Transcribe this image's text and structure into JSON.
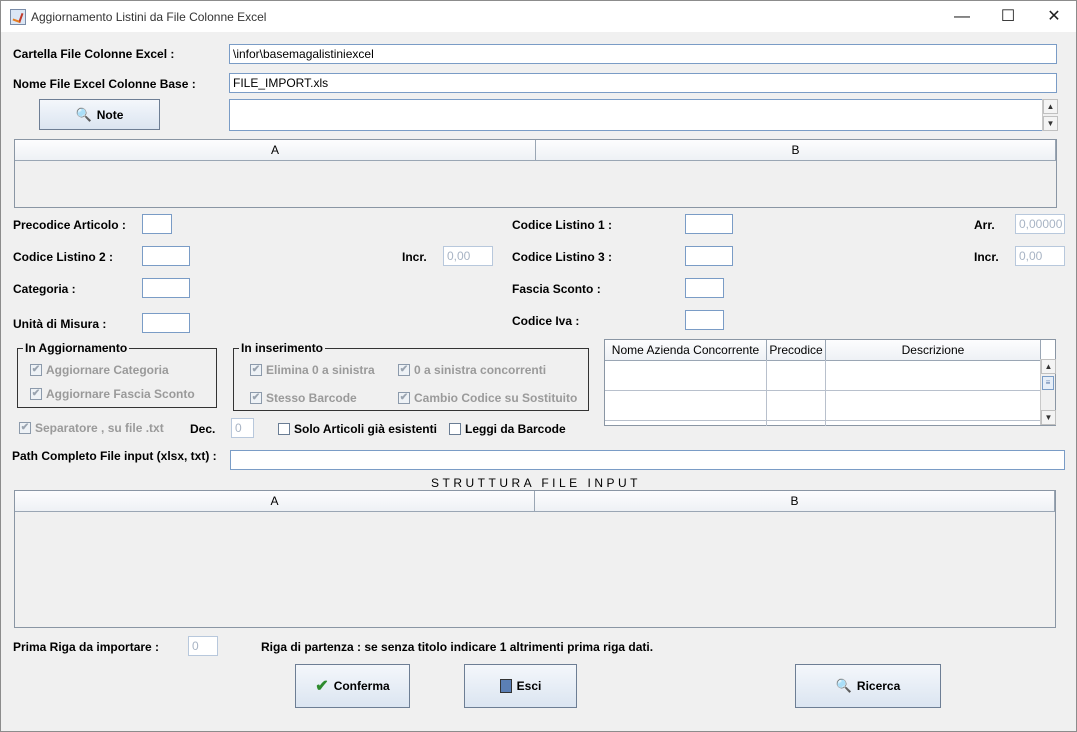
{
  "window": {
    "title": "Aggiornamento Listini da File Colonne Excel",
    "controls": {
      "minimize": "—",
      "maximize": "☐",
      "close": "✕"
    }
  },
  "form": {
    "cartella_label": "Cartella File Colonne Excel :",
    "cartella_value": "\\infor\\basemagalistiniexcel",
    "nomefile_label": "Nome File Excel Colonne Base :",
    "nomefile_value": "FILE_IMPORT.xls",
    "note_button": "Note",
    "precodice_label": "Precodice Articolo :",
    "cod_listino1_label": "Codice Listino 1 :",
    "arr_label": "Arr.",
    "arr_value": "0,00000",
    "cod_listino2_label": "Codice Listino 2 :",
    "incr_label_1": "Incr.",
    "incr_value_1": "0,00",
    "cod_listino3_label": "Codice Listino 3 :",
    "incr_label_2": "Incr.",
    "incr_value_2": "0,00",
    "categoria_label": "Categoria  :",
    "fascia_label": "Fascia Sconto :",
    "unita_label": "Unità di Misura :",
    "codice_iva_label": "Codice Iva :",
    "dec_label": "Dec.",
    "dec_value": "0",
    "path_label": "Path Completo File input (xlsx, txt) :",
    "prima_riga_label": "Prima Riga da importare :",
    "prima_riga_value": "0",
    "riga_partenza_note": "Riga di partenza : se senza titolo indicare 1 altrimenti prima riga dati."
  },
  "top_table": {
    "columns": [
      "A",
      "B"
    ]
  },
  "structure": {
    "title": "STRUTTURA FILE INPUT",
    "columns": [
      "A",
      "B"
    ]
  },
  "group_aggiornamento": {
    "title": "In Aggiornamento",
    "items": [
      "Aggiornare Categoria",
      "Aggiornare Fascia Sconto"
    ]
  },
  "group_inserimento": {
    "title": "In inserimento",
    "items": [
      "Elimina 0 a sinistra",
      "0 a sinistra concorrenti",
      "Stesso Barcode",
      "Cambio Codice su Sostituito"
    ]
  },
  "checkboxes": {
    "separatore": "Separatore , su file .txt",
    "solo_articoli": "Solo Articoli già esistenti",
    "leggi_barcode": "Leggi da Barcode"
  },
  "competitors_table": {
    "columns": [
      "Nome Azienda Concorrente",
      "Precodice",
      "Descrizione"
    ]
  },
  "buttons": {
    "conferma": "Conferma",
    "esci": "Esci",
    "ricerca": "Ricerca"
  },
  "colors": {
    "accent_border": "#7a9cc6",
    "background": "#f0f0f0"
  }
}
